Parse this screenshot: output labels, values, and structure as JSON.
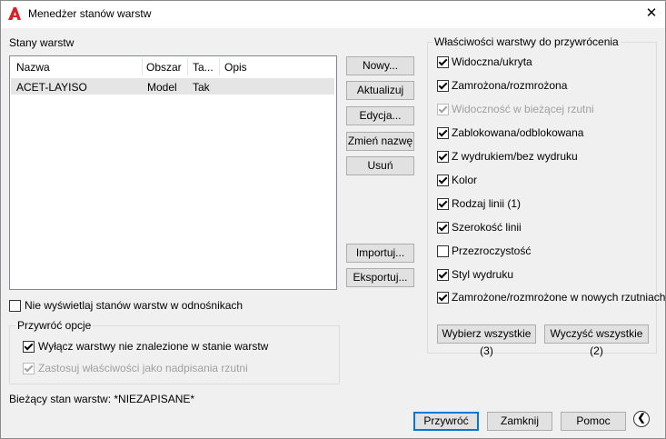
{
  "window": {
    "title": "Menedżer stanów warstw",
    "close_glyph": "✕",
    "icon": "autocad-a-icon",
    "accent_color": "#d2232a"
  },
  "left": {
    "section_label": "Stany warstw",
    "columns": [
      "Nazwa",
      "Obszar",
      "Ta...",
      "Opis"
    ],
    "rows": [
      {
        "name": "ACET-LAYISO",
        "space": "Model",
        "ta": "Tak",
        "desc": ""
      }
    ],
    "no_xref_label": "Nie wyświetlaj stanów warstw w odnośnikach",
    "no_xref_checked": false,
    "restore_group": {
      "title": "Przywróć opcje",
      "opt1_label": "Wyłącz warstwy nie znalezione w stanie warstw",
      "opt1_checked": true,
      "opt2_label": "Zastosuj właściwości jako nadpisania rzutni",
      "opt2_checked": true,
      "opt2_disabled": true
    },
    "current_state": "Bieżący stan warstw: *NIEZAPISANE*"
  },
  "middle_buttons": {
    "new": "Nowy...",
    "update": "Aktualizuj",
    "edit": "Edycja...",
    "rename": "Zmień nazwę",
    "delete": "Usuń",
    "import": "Importuj...",
    "export": "Eksportuj..."
  },
  "properties": {
    "title": "Właściwości warstwy do przywrócenia",
    "items": [
      {
        "label": "Widoczna/ukryta",
        "checked": true,
        "disabled": false
      },
      {
        "label": "Zamrożona/rozmrożona",
        "checked": true,
        "disabled": false
      },
      {
        "label": "Widoczność w bieżącej rzutni",
        "checked": true,
        "disabled": true
      },
      {
        "label": "Zablokowana/odblokowana",
        "checked": true,
        "disabled": false
      },
      {
        "label": "Z wydrukiem/bez wydruku",
        "checked": true,
        "disabled": false
      },
      {
        "label": "Kolor",
        "checked": true,
        "disabled": false
      },
      {
        "label": "Rodzaj linii (1)",
        "checked": true,
        "disabled": false
      },
      {
        "label": "Szerokość linii",
        "checked": true,
        "disabled": false
      },
      {
        "label": "Przezroczystość",
        "checked": false,
        "disabled": false
      },
      {
        "label": "Styl wydruku",
        "checked": true,
        "disabled": false
      },
      {
        "label": "Zamrożone/rozmrożone w nowych rzutniach",
        "checked": true,
        "disabled": false
      }
    ],
    "select_all": "Wybierz wszystkie (3)",
    "clear_all": "Wyczyść wszystkie (2)"
  },
  "footer": {
    "restore": "Przywróć",
    "close": "Zamknij",
    "help": "Pomoc",
    "collapse_glyph": "❮"
  }
}
